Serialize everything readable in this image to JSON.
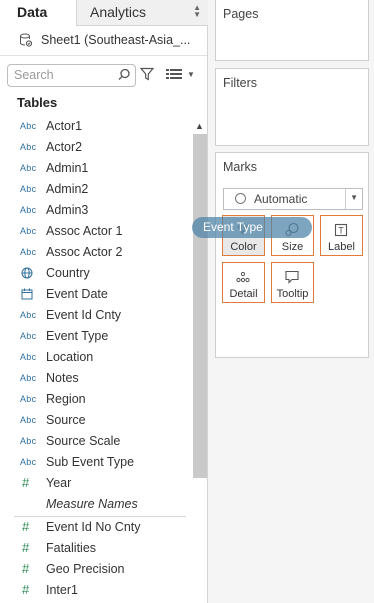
{
  "tabs": {
    "data": "Data",
    "analytics": "Analytics"
  },
  "datasource": {
    "name": "Sheet1 (Southeast-Asia_..."
  },
  "search": {
    "placeholder": "Search"
  },
  "tables": {
    "heading": "Tables",
    "fields": [
      {
        "type": "Abc",
        "name": "Actor1"
      },
      {
        "type": "Abc",
        "name": "Actor2"
      },
      {
        "type": "Abc",
        "name": "Admin1"
      },
      {
        "type": "Abc",
        "name": "Admin2"
      },
      {
        "type": "Abc",
        "name": "Admin3"
      },
      {
        "type": "Abc",
        "name": "Assoc Actor 1"
      },
      {
        "type": "Abc",
        "name": "Assoc Actor 2"
      },
      {
        "type": "globe",
        "name": "Country"
      },
      {
        "type": "calendar",
        "name": "Event Date"
      },
      {
        "type": "Abc",
        "name": "Event Id Cnty"
      },
      {
        "type": "Abc",
        "name": "Event Type"
      },
      {
        "type": "Abc",
        "name": "Location"
      },
      {
        "type": "Abc",
        "name": "Notes"
      },
      {
        "type": "Abc",
        "name": "Region"
      },
      {
        "type": "Abc",
        "name": "Source"
      },
      {
        "type": "Abc",
        "name": "Source Scale"
      },
      {
        "type": "Abc",
        "name": "Sub Event Type"
      },
      {
        "type": "#",
        "name": "Year"
      },
      {
        "type": "none",
        "name": "Measure Names"
      },
      {
        "type": "#",
        "name": "Event Id No Cnty"
      },
      {
        "type": "#",
        "name": "Fatalities"
      },
      {
        "type": "#",
        "name": "Geo Precision"
      },
      {
        "type": "#",
        "name": "Inter1"
      }
    ]
  },
  "pages": {
    "title": "Pages"
  },
  "filters": {
    "title": "Filters"
  },
  "marks": {
    "title": "Marks",
    "mark_type": "Automatic",
    "buttons": {
      "color": "Color",
      "size": "Size",
      "label": "Label",
      "detail": "Detail",
      "tooltip": "Tooltip"
    }
  },
  "drag_pill": {
    "label": "Event Type"
  },
  "colors": {
    "accent_orange": "#e07b3a",
    "dimension_blue": "#2e6f9e",
    "measure_green": "#2e8b57",
    "drag_blue": "#4c82a8"
  }
}
